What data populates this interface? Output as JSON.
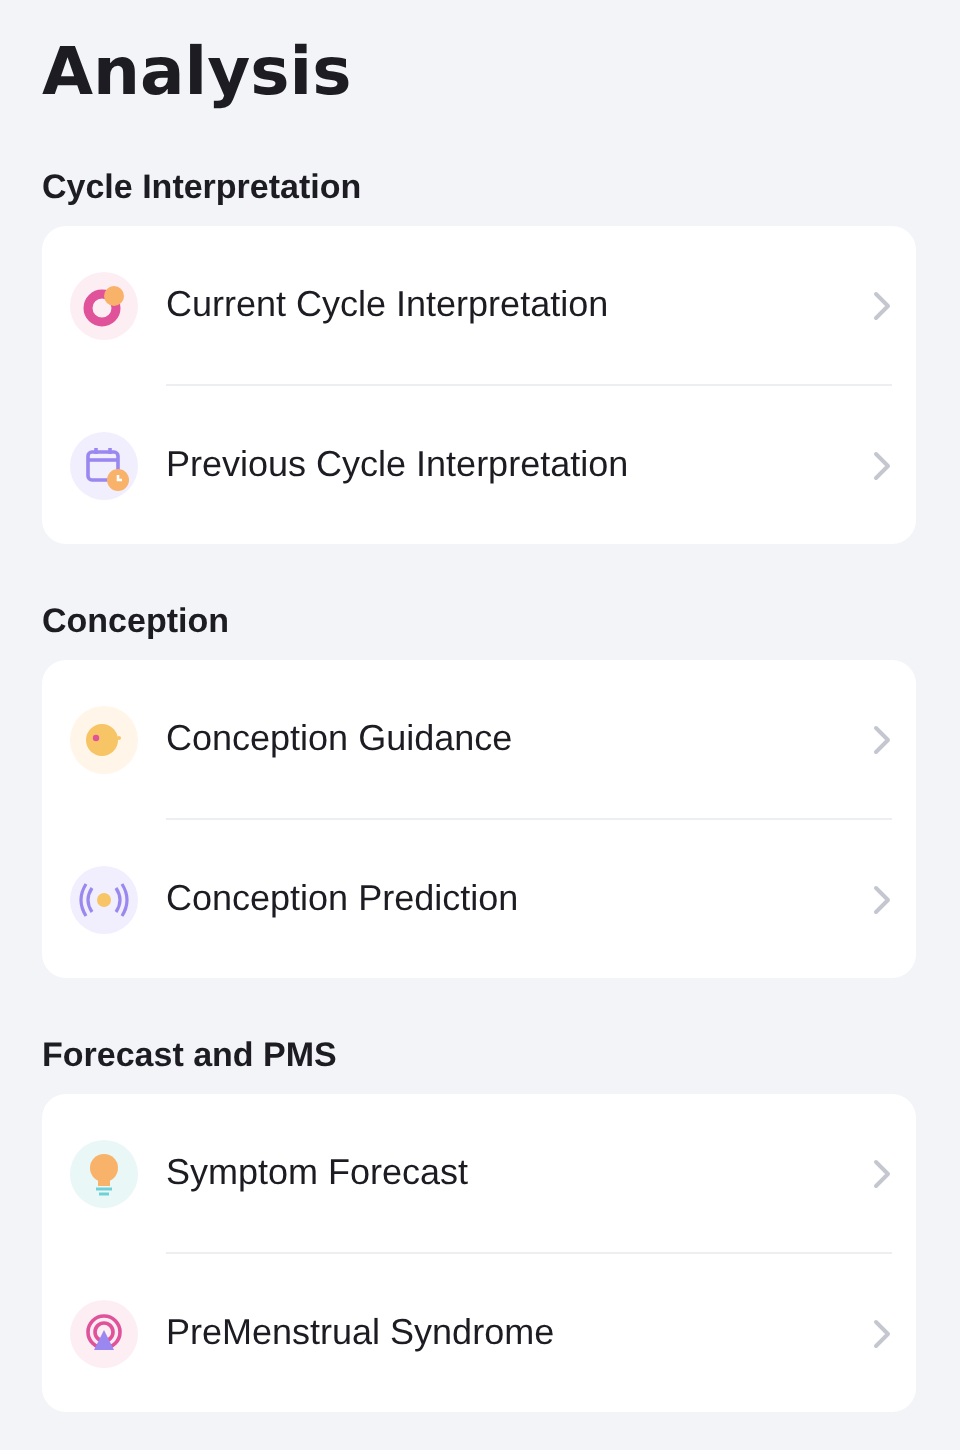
{
  "title": "Analysis",
  "sections": [
    {
      "heading": "Cycle Interpretation",
      "items": [
        {
          "kind": "cycle",
          "label": "Current Cycle Interpretation"
        },
        {
          "kind": "calendar",
          "label": "Previous Cycle Interpretation"
        }
      ]
    },
    {
      "heading": "Conception",
      "items": [
        {
          "kind": "egg",
          "label": "Conception Guidance"
        },
        {
          "kind": "signal",
          "label": "Conception Prediction"
        }
      ]
    },
    {
      "heading": "Forecast and PMS",
      "items": [
        {
          "kind": "bulb",
          "label": "Symptom Forecast"
        },
        {
          "kind": "broadcast",
          "label": "PreMenstrual Syndrome"
        }
      ]
    }
  ]
}
